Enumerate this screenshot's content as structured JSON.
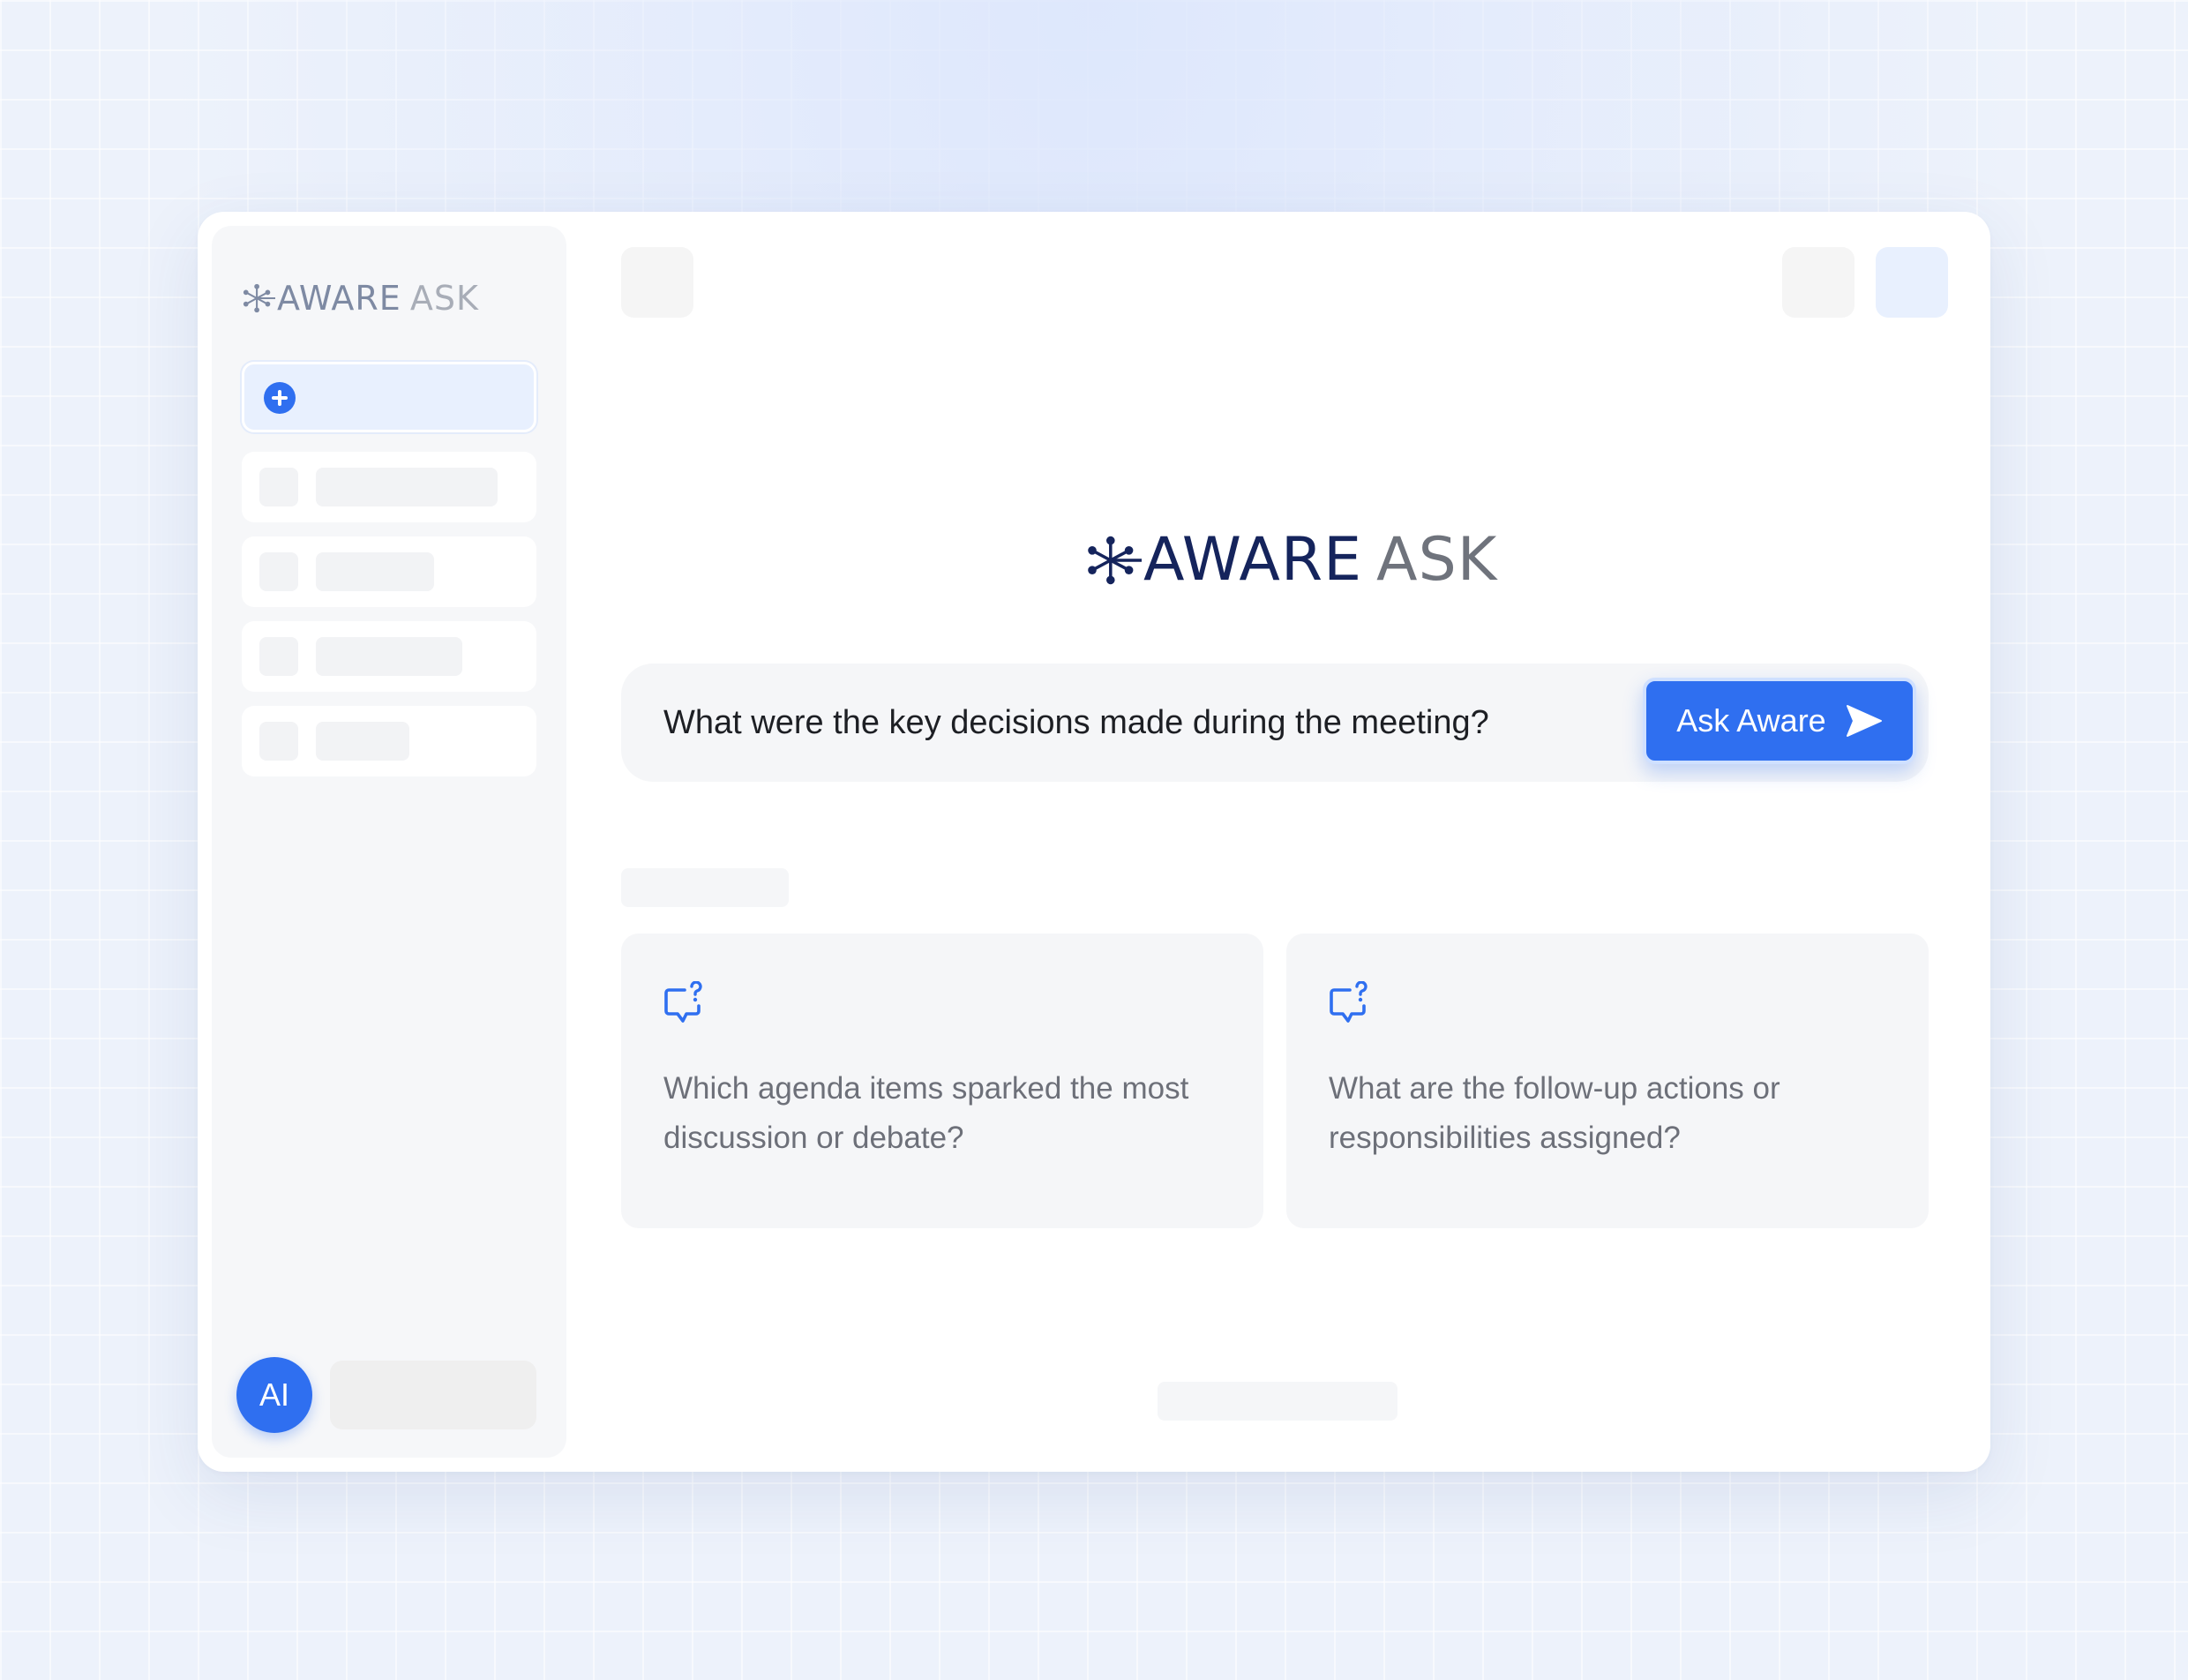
{
  "brand": {
    "name_primary": "AWARE",
    "name_secondary": "ASK",
    "accent_color": "#2f6ff0",
    "navy_color": "#15245c"
  },
  "sidebar": {
    "new_chat_icon": "plus-circle-icon",
    "history_item_count_visible": 4,
    "user": {
      "avatar_initials": "AI"
    }
  },
  "main": {
    "search": {
      "value": "What were the key decisions made during the meeting?",
      "button_label": "Ask Aware",
      "button_icon": "send-icon"
    },
    "suggestions": [
      {
        "icon": "question-chat-icon",
        "text": "Which agenda items sparked the most discussion or debate?"
      },
      {
        "icon": "question-chat-icon",
        "text": "What are the follow-up actions or responsibilities assigned?"
      }
    ]
  }
}
